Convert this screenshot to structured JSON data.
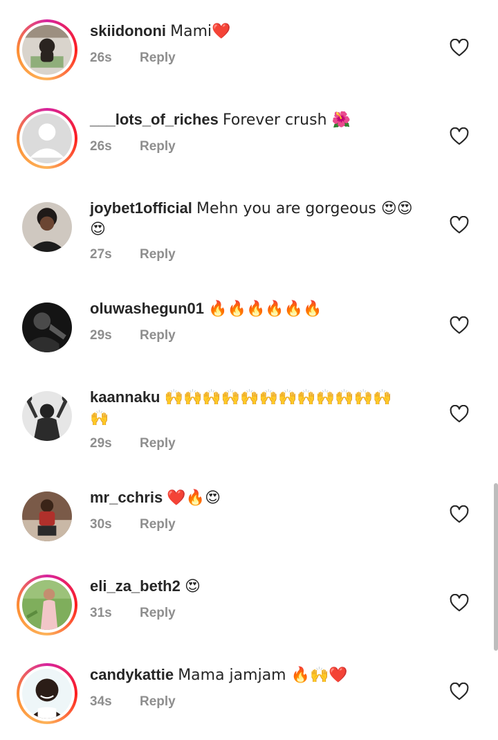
{
  "comments": [
    {
      "username": "skiidononi",
      "text": "Mami❤️",
      "time": "26s",
      "reply": "Reply",
      "ring": true
    },
    {
      "username": "___lots_of_riches",
      "text": "Forever crush 🌺",
      "time": "26s",
      "reply": "Reply",
      "ring": true
    },
    {
      "username": "joybet1official",
      "text": "Mehn you are gorgeous 😍😍",
      "text2": "😍",
      "time": "27s",
      "reply": "Reply",
      "ring": false
    },
    {
      "username": "oluwashegun01",
      "text": "🔥🔥🔥🔥🔥🔥",
      "time": "29s",
      "reply": "Reply",
      "ring": false
    },
    {
      "username": "kaannaku",
      "text": "🙌🙌🙌🙌🙌🙌🙌🙌🙌🙌🙌🙌",
      "text2": "🙌",
      "time": "29s",
      "reply": "Reply",
      "ring": false
    },
    {
      "username": "mr_cchris",
      "text": "❤️🔥😍",
      "time": "30s",
      "reply": "Reply",
      "ring": false
    },
    {
      "username": "eli_za_beth2",
      "text": "😍",
      "time": "31s",
      "reply": "Reply",
      "ring": true
    },
    {
      "username": "candykattie",
      "text": "Mama jamjam 🔥🙌❤️",
      "time": "34s",
      "reply": "Reply",
      "ring": true
    }
  ],
  "icons": {
    "like": "heart-outline-icon"
  },
  "colors": {
    "text": "#262626",
    "meta": "#8e8e8e",
    "ring_start": "#d6249f",
    "ring_end": "#fdb35a"
  }
}
